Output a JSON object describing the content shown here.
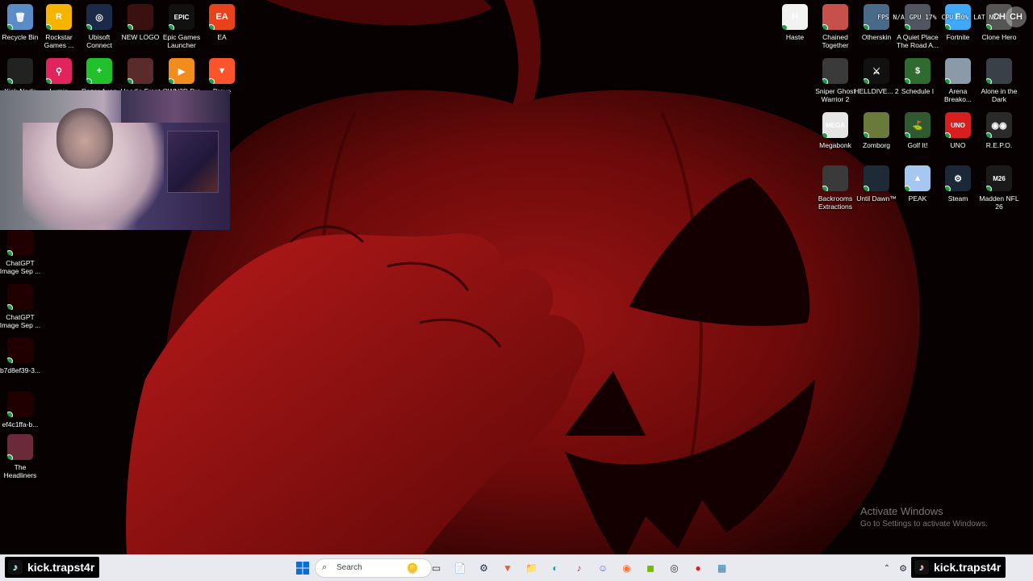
{
  "desktop": {
    "left_icons": [
      {
        "label": "Recycle Bin",
        "icon": "recycle-bin-icon",
        "color": "#5a8cc8",
        "glyph": "🗑"
      },
      {
        "label": "Rockstar Games ...",
        "icon": "rockstar-icon",
        "color": "#f4b400",
        "glyph": "R"
      },
      {
        "label": "Ubisoft Connect",
        "icon": "ubisoft-icon",
        "color": "#1c2a4a",
        "glyph": "◎"
      },
      {
        "label": "NEW LOGO",
        "icon": "new-logo-icon",
        "color": "#3a1010",
        "glyph": ""
      },
      {
        "label": "Epic Games Launcher",
        "icon": "epic-games-icon",
        "color": "#111111",
        "glyph": "EPIC"
      },
      {
        "label": "EA",
        "icon": "ea-icon",
        "color": "#e8421d",
        "glyph": "EA"
      },
      {
        "label": "Kick-Nedir",
        "icon": "kick-nedir-icon",
        "color": "#222222",
        "glyph": ""
      },
      {
        "label": "Lumia",
        "icon": "lumia-icon",
        "color": "#e0245e",
        "glyph": "⚲"
      },
      {
        "label": "Razer Axon",
        "icon": "razer-axon-icon",
        "color": "#22c02a",
        "glyph": "+"
      },
      {
        "label": "Hoodie Front",
        "icon": "hoodie-front-icon",
        "color": "#5a2b2b",
        "glyph": ""
      },
      {
        "label": "OWN3D Pro",
        "icon": "own3d-pro-icon",
        "color": "#f28c1c",
        "glyph": "▶"
      },
      {
        "label": "Brave",
        "icon": "brave-icon",
        "color": "#fb542b",
        "glyph": "▼"
      },
      {
        "label": "ChatGPT Image Sep ...",
        "icon": "image-file-icon",
        "color": "#200000",
        "glyph": ""
      },
      {
        "label": "ChatGPT Image Sep ...",
        "icon": "image-file-icon",
        "color": "#200000",
        "glyph": ""
      },
      {
        "label": "b7d8ef39-3...",
        "icon": "image-file-icon",
        "color": "#200000",
        "glyph": ""
      },
      {
        "label": "ef4c1ffa-b...",
        "icon": "image-file-icon",
        "color": "#200000",
        "glyph": ""
      },
      {
        "label": "The Headliners",
        "icon": "the-headliners-icon",
        "color": "#6a2a3a",
        "glyph": ""
      }
    ],
    "right_icons": [
      {
        "label": "Haste",
        "icon": "haste-icon",
        "color": "#f2f2f2",
        "glyph": "H"
      },
      {
        "label": "Chained Together",
        "icon": "chained-together-icon",
        "color": "#c8504a",
        "glyph": ""
      },
      {
        "label": "Otherskin",
        "icon": "otherskin-icon",
        "color": "#4a6a8a",
        "glyph": ""
      },
      {
        "label": "A Quiet Place The Road A...",
        "icon": "quiet-place-icon",
        "color": "#505560",
        "glyph": ""
      },
      {
        "label": "Fortnite",
        "icon": "fortnite-icon",
        "color": "#3fa9f5",
        "glyph": "F"
      },
      {
        "label": "Clone Hero",
        "icon": "clone-hero-icon",
        "color": "#555555",
        "glyph": "CH"
      },
      {
        "label": "Sniper Ghost Warrior 2",
        "icon": "sniper-ghost-icon",
        "color": "#3a3a3a",
        "glyph": ""
      },
      {
        "label": "HELLDIVE... 2",
        "icon": "helldivers-icon",
        "color": "#111111",
        "glyph": "⚔"
      },
      {
        "label": "Schedule I",
        "icon": "schedule-i-icon",
        "color": "#2f6a2f",
        "glyph": "$"
      },
      {
        "label": "Arena Breako...",
        "icon": "arena-breakout-icon",
        "color": "#8a9aa8",
        "glyph": ""
      },
      {
        "label": "Alone in the Dark",
        "icon": "alone-in-dark-icon",
        "color": "#3a4048",
        "glyph": ""
      },
      {
        "label": "Megabonk",
        "icon": "megabonk-icon",
        "color": "#e6e6e6",
        "glyph": "MEGA"
      },
      {
        "label": "Zomborg",
        "icon": "zomborg-icon",
        "color": "#6a7a3a",
        "glyph": ""
      },
      {
        "label": "Golf It!",
        "icon": "golf-it-icon",
        "color": "#2f5a2f",
        "glyph": "⛳"
      },
      {
        "label": "UNO",
        "icon": "uno-icon",
        "color": "#d81e1e",
        "glyph": "UNO"
      },
      {
        "label": "R.E.P.O.",
        "icon": "repo-icon",
        "color": "#2a2a2a",
        "glyph": "◉◉"
      },
      {
        "label": "Backrooms Extractions",
        "icon": "backrooms-icon",
        "color": "#3a3a3a",
        "glyph": ""
      },
      {
        "label": "Until Dawn™",
        "icon": "until-dawn-icon",
        "color": "#1e2a36",
        "glyph": ""
      },
      {
        "label": "PEAK",
        "icon": "peak-icon",
        "color": "#a6c8f0",
        "glyph": "▲"
      },
      {
        "label": "Steam",
        "icon": "steam-icon",
        "color": "#1b2838",
        "glyph": "⚙"
      },
      {
        "label": "Madden NFL 26",
        "icon": "madden-icon",
        "color": "#1a1a1a",
        "glyph": "M26"
      }
    ]
  },
  "activation": {
    "title": "Activate Windows",
    "subtitle": "Go to Settings to activate Windows."
  },
  "overlay": {
    "fps": "FPS N/A",
    "gpu": "GPU 17%",
    "cpu": "CPU 30%",
    "lat": "LAT N/A",
    "badge": "CH"
  },
  "taskbar": {
    "search_placeholder": "Search",
    "apps": [
      {
        "name": "taskbar-widgets",
        "glyph": "🪙",
        "color": "#c79a2c"
      },
      {
        "name": "taskbar-task-view",
        "glyph": "▭",
        "color": "#333333"
      },
      {
        "name": "taskbar-notepad",
        "glyph": "📄",
        "color": "#1e88e5"
      },
      {
        "name": "taskbar-steam",
        "glyph": "⚙",
        "color": "#1b2838"
      },
      {
        "name": "taskbar-brave",
        "glyph": "▼",
        "color": "#fb542b"
      },
      {
        "name": "taskbar-file-explorer",
        "glyph": "📁",
        "color": "#f4c542"
      },
      {
        "name": "taskbar-edge",
        "glyph": "◐",
        "color": "#0aa0c8"
      },
      {
        "name": "taskbar-tiktok",
        "glyph": "♪",
        "color": "#e0245e"
      },
      {
        "name": "taskbar-discord",
        "glyph": "☺",
        "color": "#5865f2"
      },
      {
        "name": "taskbar-firefox",
        "glyph": "◉",
        "color": "#ff7139"
      },
      {
        "name": "taskbar-nvidia",
        "glyph": "◼",
        "color": "#76b900"
      },
      {
        "name": "taskbar-obs",
        "glyph": "◎",
        "color": "#302e31"
      },
      {
        "name": "taskbar-app-red",
        "glyph": "●",
        "color": "#d81e1e"
      },
      {
        "name": "taskbar-app-photos",
        "glyph": "▦",
        "color": "#2a7ab8"
      }
    ]
  },
  "stream_overlay": {
    "left_handle": "kick.trapst4r",
    "right_handle": "kick.trapst4r"
  },
  "colors": {
    "wallpaper": "#7a0a0a",
    "taskbar": "#e9eaf0",
    "check": "#1f9e4a"
  }
}
